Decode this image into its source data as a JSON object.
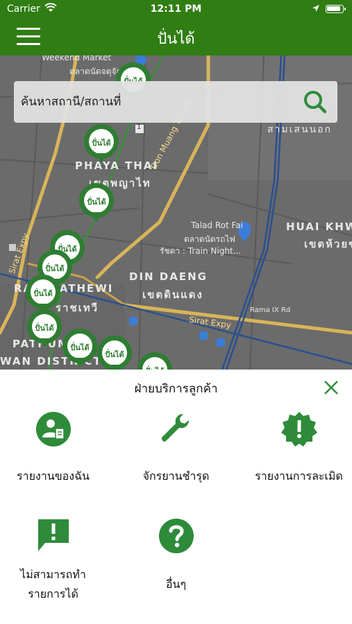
{
  "status_bar": {
    "carrier": "Carrier",
    "time": "12:11 PM"
  },
  "nav": {
    "title": "ปั่นได้",
    "menu_icon": "hamburger-icon"
  },
  "search": {
    "placeholder": "ค้นหาสถานี/สถานที่",
    "icon": "search-icon"
  },
  "map": {
    "labels": {
      "weekend_market": "Weekend Market",
      "weekend_market_th": "ตลาดนัดจตุจักร",
      "phaya_thai": "PHAYA THAI",
      "phaya_thai_th": "เขตพญาไท",
      "don_muang": "Don Muang Toll Way",
      "talad_rot_fai": "Talad Rot Fai",
      "talad_rot_fai_th": "ตลาดนัดรถไฟ",
      "train_night": "รัชดา : Train Night...",
      "huai_khwang": "HUAI KHW",
      "huai_khwang_th": "เขตห้วยข",
      "samsen": "สามเสนนอก",
      "din_daeng": "DIN DAENG",
      "din_daeng_th": "เขตดินแดง",
      "ratchathewi": "RATCHATHEWI",
      "ratchathewi_th": "ราชเทวี",
      "sirat_expy": "Sirat Expy",
      "sirat_expy_left": "Sirat Expy",
      "rama_ix": "Rama IX Rd",
      "pathum": "PATHUM",
      "wan_district": "WAN DISTRICT",
      "road_1": "1"
    },
    "pin_label": "ปั่นได้"
  },
  "sheet": {
    "title": "ฝ่ายบริการลูกค้า",
    "options": [
      {
        "label": "รายงานของฉัน",
        "icon": "user-report-icon"
      },
      {
        "label": "จักรยานชำรุด",
        "icon": "wrench-icon"
      },
      {
        "label": "รายงานการละเมิด",
        "icon": "alert-badge-icon"
      },
      {
        "label_line1": "ไม่สามารถทำ",
        "label_line2": "รายการได้",
        "icon": "alert-message-icon"
      },
      {
        "label": "อื่นๆ",
        "icon": "question-icon"
      }
    ]
  },
  "colors": {
    "brand_green": "#2f7d13",
    "icon_green": "#2e8b3a"
  }
}
